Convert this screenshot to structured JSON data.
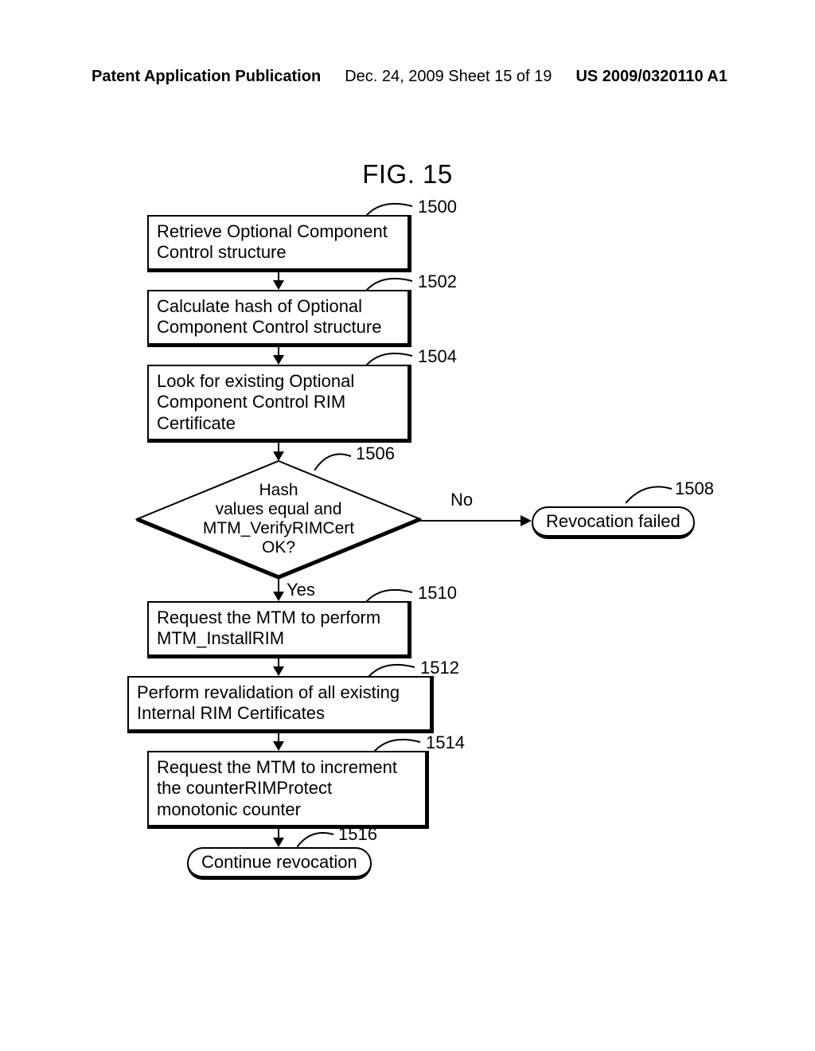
{
  "header": {
    "left": "Patent Application Publication",
    "center": "Dec. 24, 2009  Sheet 15 of 19",
    "right": "US 2009/0320110 A1"
  },
  "figure_title": "FIG. 15",
  "refs": {
    "r1500": "1500",
    "r1502": "1502",
    "r1504": "1504",
    "r1506": "1506",
    "r1508": "1508",
    "r1510": "1510",
    "r1512": "1512",
    "r1514": "1514",
    "r1516": "1516"
  },
  "boxes": {
    "b1500": "Retrieve Optional Component Control structure",
    "b1502": "Calculate hash of Optional Component Control structure",
    "b1504": "Look for existing Optional Component Control RIM Certificate",
    "b1506": "Hash\nvalues equal and\nMTM_VerifyRIMCert\nOK?",
    "b1508": "Revocation failed",
    "b1510": "Request the MTM to perform MTM_InstallRIM",
    "b1512": "Perform revalidation of all existing Internal RIM Certificates",
    "b1514": "Request the MTM to increment the counterRIMProtect monotonic counter",
    "b1516": "Continue revocation"
  },
  "labels": {
    "yes": "Yes",
    "no": "No"
  },
  "chart_data": {
    "type": "flowchart",
    "title": "FIG. 15",
    "nodes": [
      {
        "id": "1500",
        "type": "process",
        "text": "Retrieve Optional Component Control structure"
      },
      {
        "id": "1502",
        "type": "process",
        "text": "Calculate hash of Optional Component Control structure"
      },
      {
        "id": "1504",
        "type": "process",
        "text": "Look for existing Optional Component Control RIM Certificate"
      },
      {
        "id": "1506",
        "type": "decision",
        "text": "Hash values equal and MTM_VerifyRIMCert OK?"
      },
      {
        "id": "1508",
        "type": "terminator",
        "text": "Revocation failed"
      },
      {
        "id": "1510",
        "type": "process",
        "text": "Request the MTM to perform MTM_InstallRIM"
      },
      {
        "id": "1512",
        "type": "process",
        "text": "Perform revalidation of all existing Internal RIM Certificates"
      },
      {
        "id": "1514",
        "type": "process",
        "text": "Request the MTM to increment the counterRIMProtect monotonic counter"
      },
      {
        "id": "1516",
        "type": "terminator",
        "text": "Continue revocation"
      }
    ],
    "edges": [
      {
        "from": "1500",
        "to": "1502",
        "label": ""
      },
      {
        "from": "1502",
        "to": "1504",
        "label": ""
      },
      {
        "from": "1504",
        "to": "1506",
        "label": ""
      },
      {
        "from": "1506",
        "to": "1508",
        "label": "No"
      },
      {
        "from": "1506",
        "to": "1510",
        "label": "Yes"
      },
      {
        "from": "1510",
        "to": "1512",
        "label": ""
      },
      {
        "from": "1512",
        "to": "1514",
        "label": ""
      },
      {
        "from": "1514",
        "to": "1516",
        "label": ""
      }
    ]
  }
}
